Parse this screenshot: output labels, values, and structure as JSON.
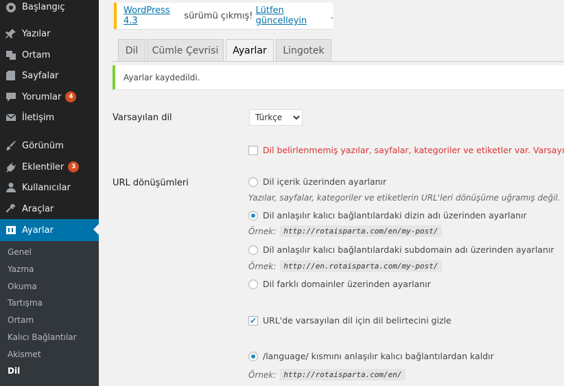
{
  "sidebar": {
    "items": [
      {
        "label": "Başlangıç",
        "icon": "dashboard-icon"
      },
      {
        "label": "Yazılar",
        "icon": "pin-icon"
      },
      {
        "label": "Ortam",
        "icon": "media-icon"
      },
      {
        "label": "Sayfalar",
        "icon": "pages-icon"
      },
      {
        "label": "Yorumlar",
        "icon": "comments-icon",
        "badge": "4"
      },
      {
        "label": "İletişim",
        "icon": "mail-icon"
      },
      {
        "label": "Görünüm",
        "icon": "brush-icon"
      },
      {
        "label": "Eklentiler",
        "icon": "plugin-icon",
        "badge": "3"
      },
      {
        "label": "Kullanıcılar",
        "icon": "user-icon"
      },
      {
        "label": "Araçlar",
        "icon": "wrench-icon"
      },
      {
        "label": "Ayarlar",
        "icon": "settings-icon"
      }
    ],
    "submenu": [
      "Genel",
      "Yazma",
      "Okuma",
      "Tartışma",
      "Ortam",
      "Kalıcı Bağlantılar",
      "Akismet",
      "Dil"
    ]
  },
  "update_nag": {
    "link1": "WordPress 4.3",
    "middle": " sürümü çıkmış! ",
    "link2": "Lütfen güncelleyin",
    "end": "."
  },
  "tabs": [
    "Dil",
    "Cümle Çevrisi",
    "Ayarlar",
    "Lingotek"
  ],
  "notice": "Ayarlar kaydedildi.",
  "settings": {
    "default_language_label": "Varsayılan dil",
    "default_language_value": "Türkçe",
    "warning_text": "Dil belirlenmemiş yazılar, sayfalar, kategoriler ve etiketler var. Varsayılan di",
    "url_label": "URL dönüşümleri",
    "opt1": "Dil içerik üzerinden ayarlanır",
    "opt1_desc": "Yazılar, sayfalar, kategoriler ve etiketlerin URL'leri dönüşüme uğramış değil.",
    "opt2": "Dil anlaşılır kalıcı bağlantılardaki dizin adı üzerinden ayarlanır",
    "example_label": "Örnek:",
    "opt2_example": "http://rotaisparta.com/en/my-post/",
    "opt3": "Dil anlaşılır kalıcı bağlantılardaki subdomain adı üzerinden ayarlanır",
    "opt3_example": "http://en.rotaisparta.com/my-post/",
    "opt4": "Dil farklı domainler üzerinden ayarlanır",
    "hide_default": "URL'de varsayılan dil için dil belirtecini gizle",
    "remove_language": "/language/ kısmını anlaşılır kalıcı bağlantılardan kaldır",
    "remove_example": "http://rotaisparta.com/en/"
  }
}
